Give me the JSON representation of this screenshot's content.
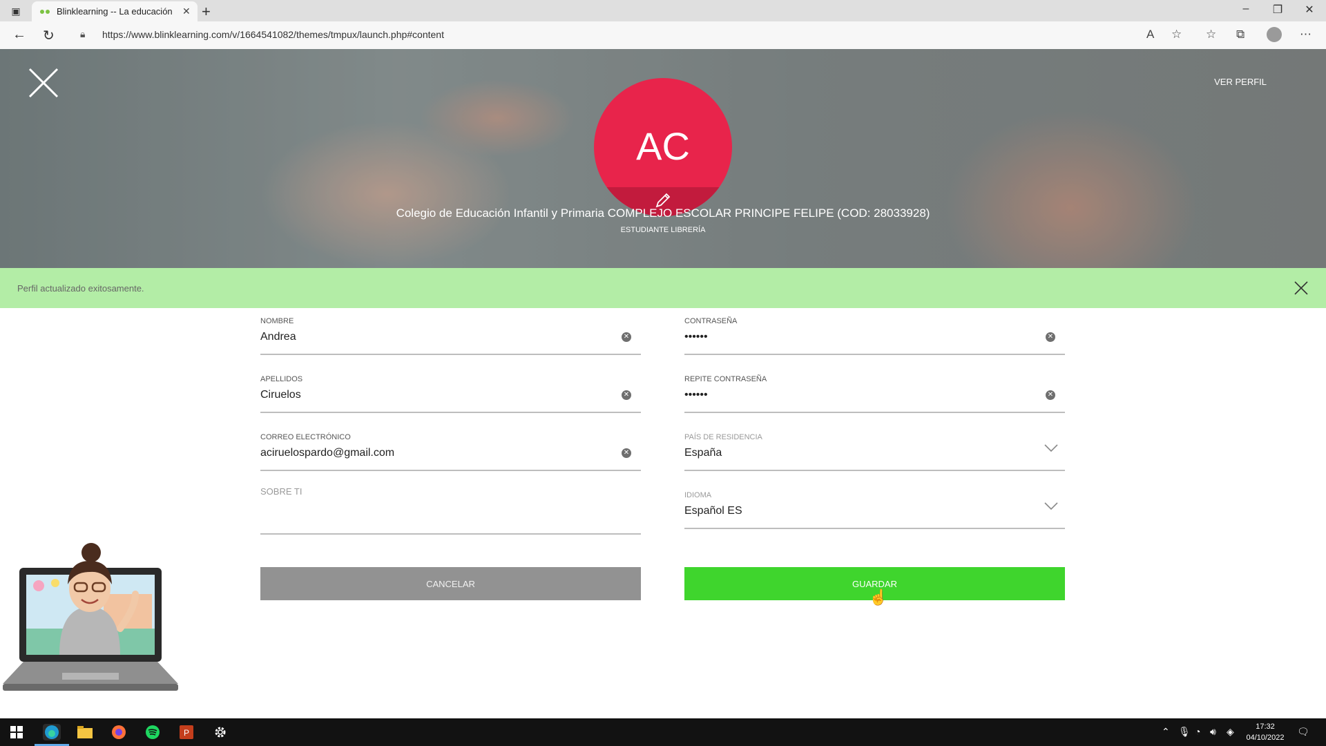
{
  "browser": {
    "tab_title": "Blinklearning -- La educación pe",
    "url": "https://www.blinklearning.com/v/1664541082/themes/tmpux/launch.php#content"
  },
  "header": {
    "ver_perfil": "VER PERFIL",
    "avatar_initials": "AC",
    "school": "Colegio de Educación Infantil y Primaria COMPLEJO ESCOLAR PRINCIPE FELIPE (COD: 28033928)",
    "role": "ESTUDIANTE LIBRERÍA"
  },
  "banner": {
    "message": "Perfil actualizado exitosamente."
  },
  "form": {
    "nombre": {
      "label": "NOMBRE",
      "value": "Andrea"
    },
    "apellidos": {
      "label": "APELLIDOS",
      "value": "Ciruelos"
    },
    "correo": {
      "label": "CORREO ELECTRÓNICO",
      "value": "aciruelospardo@gmail.com"
    },
    "sobre_ti": {
      "label": "SOBRE TI",
      "value": ""
    },
    "contrasena": {
      "label": "CONTRASEÑA",
      "value": "••••••"
    },
    "repite": {
      "label": "REPITE CONTRASEÑA",
      "value": "••••••"
    },
    "pais": {
      "label": "PAÍS DE RESIDENCIA",
      "value": "España"
    },
    "idioma": {
      "label": "IDIOMA",
      "value": "Español ES"
    },
    "cancel_label": "CANCELAR",
    "save_label": "GUARDAR"
  },
  "taskbar": {
    "time": "17:32",
    "date": "04/10/2022"
  },
  "colors": {
    "avatar": "#e8244b",
    "banner": "#b3eda6",
    "save": "#3fd52d",
    "cancel": "#929292"
  }
}
